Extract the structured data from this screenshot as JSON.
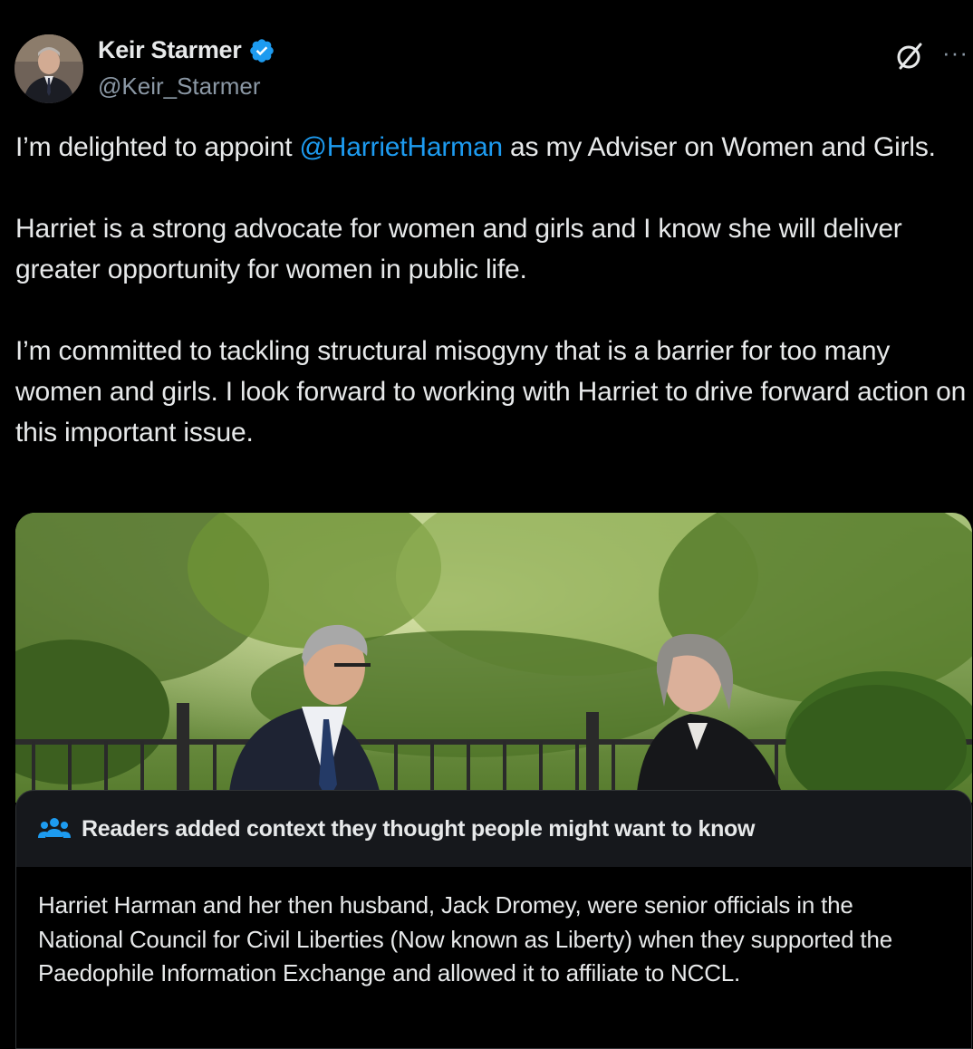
{
  "author": {
    "display_name": "Keir Starmer",
    "handle": "@Keir_Starmer",
    "verified_icon": "verified-badge-icon",
    "avatar_icon": "profile-avatar"
  },
  "actions": {
    "grok_icon": "grok-slash-icon",
    "more_label": "···"
  },
  "tweet": {
    "p1_before": "I’m delighted to appoint ",
    "p1_mention": "@HarrietHarman",
    "p1_after": " as my Adviser on Women and Girls.",
    "p2": "Harriet is a strong advocate for women and girls and I know she will deliver greater opportunity for women in public life.",
    "p3": "I’m committed to tackling structural misogyny that is a barrier for too many women and girls. I look forward to working with Harriet to drive forward action on this important issue."
  },
  "media": {
    "type": "photo"
  },
  "community_note": {
    "icon": "readers-people-icon",
    "title": "Readers added context they thought people might want to know",
    "body": "Harriet Harman and her then husband, Jack Dromey, were senior officials in the National Council for Civil Liberties (Now known as Liberty) when they supported the Paedophile Information Exchange and allowed it to affiliate to NCCL."
  },
  "colors": {
    "background": "#000000",
    "text": "#e7e9ea",
    "secondary": "#8b98a5",
    "link": "#1d9bf0",
    "verified": "#1d9bf0",
    "note_background": "#16181c"
  }
}
